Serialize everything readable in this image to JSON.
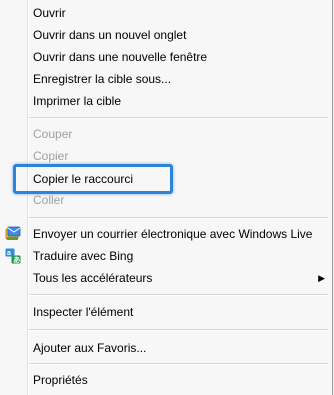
{
  "menu": {
    "items": {
      "open": "Ouvrir",
      "open_new_tab": "Ouvrir dans un nouvel onglet",
      "open_new_window": "Ouvrir dans une nouvelle fenêtre",
      "save_target": "Enregistrer la cible sous...",
      "print_target": "Imprimer la cible",
      "cut": "Couper",
      "copy": "Copier",
      "copy_shortcut": "Copier le raccourci",
      "paste": "Coller",
      "email_windows_live": "Envoyer un courrier électronique avec Windows Live",
      "translate_bing": "Traduire avec Bing",
      "all_accelerators": "Tous les accélérateurs",
      "inspect_element": "Inspecter l'élément",
      "add_favorites": "Ajouter aux Favoris...",
      "properties": "Propriétés"
    },
    "submenu_arrow": "▶",
    "icons": {
      "email": "windows-live-mail-icon",
      "translate": "bing-translate-icon"
    }
  },
  "highlight_color": "#2b84d9"
}
